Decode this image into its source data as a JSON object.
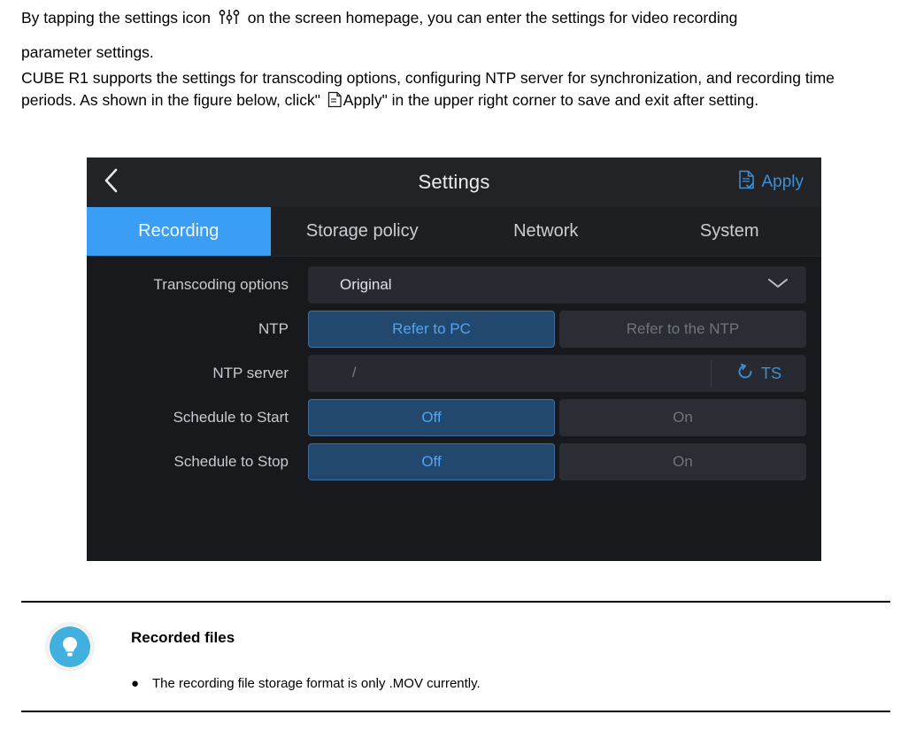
{
  "document": {
    "paragraph_1_before_icon": "By tapping the settings icon",
    "settings_icon_name": "sliders-settings-icon",
    "paragraph_1_after_icon": "on the screen homepage, you can enter the settings for video recording",
    "paragraph_2": "parameter settings.",
    "paragraph_3_before_icon": "CUBE R1 supports the settings for transcoding options, configuring NTP server for synchronization, and recording time periods. As shown in the figure below, click\"",
    "apply_icon_name": "document-apply-icon",
    "paragraph_3_after_icon": "Apply\"  in the upper right corner to save and exit after setting."
  },
  "device": {
    "header": {
      "back_icon": "chevron-left-icon",
      "title": "Settings",
      "apply_icon": "document-check-icon",
      "apply_label": "Apply",
      "accent_color": "#3d8fd8"
    },
    "tabs": [
      {
        "label": "Recording",
        "active": true
      },
      {
        "label": "Storage policy",
        "active": false
      },
      {
        "label": "Network",
        "active": false
      },
      {
        "label": "System",
        "active": false
      }
    ],
    "active_tab_color": "#3b9ef5",
    "rows": {
      "transcoding": {
        "label": "Transcoding options",
        "value": "Original",
        "chevron_icon": "chevron-down-icon"
      },
      "ntp": {
        "label": "NTP",
        "option_selected": "Refer to PC",
        "option_unselected": "Refer to the NTP"
      },
      "ntp_server": {
        "label": "NTP server",
        "value": "/",
        "ts_icon": "refresh-sync-icon",
        "ts_label": "TS"
      },
      "schedule_start": {
        "label": "Schedule to Start",
        "option_selected": "Off",
        "option_unselected": "On"
      },
      "schedule_stop": {
        "label": "Schedule to Stop",
        "option_selected": "Off",
        "option_unselected": "On"
      }
    }
  },
  "note": {
    "icon_name": "lightbulb-icon",
    "icon_color": "#41b0de",
    "title": "Recorded files",
    "bullet_marker": "●",
    "bullet_text": "The recording file storage format is only .MOV currently."
  }
}
